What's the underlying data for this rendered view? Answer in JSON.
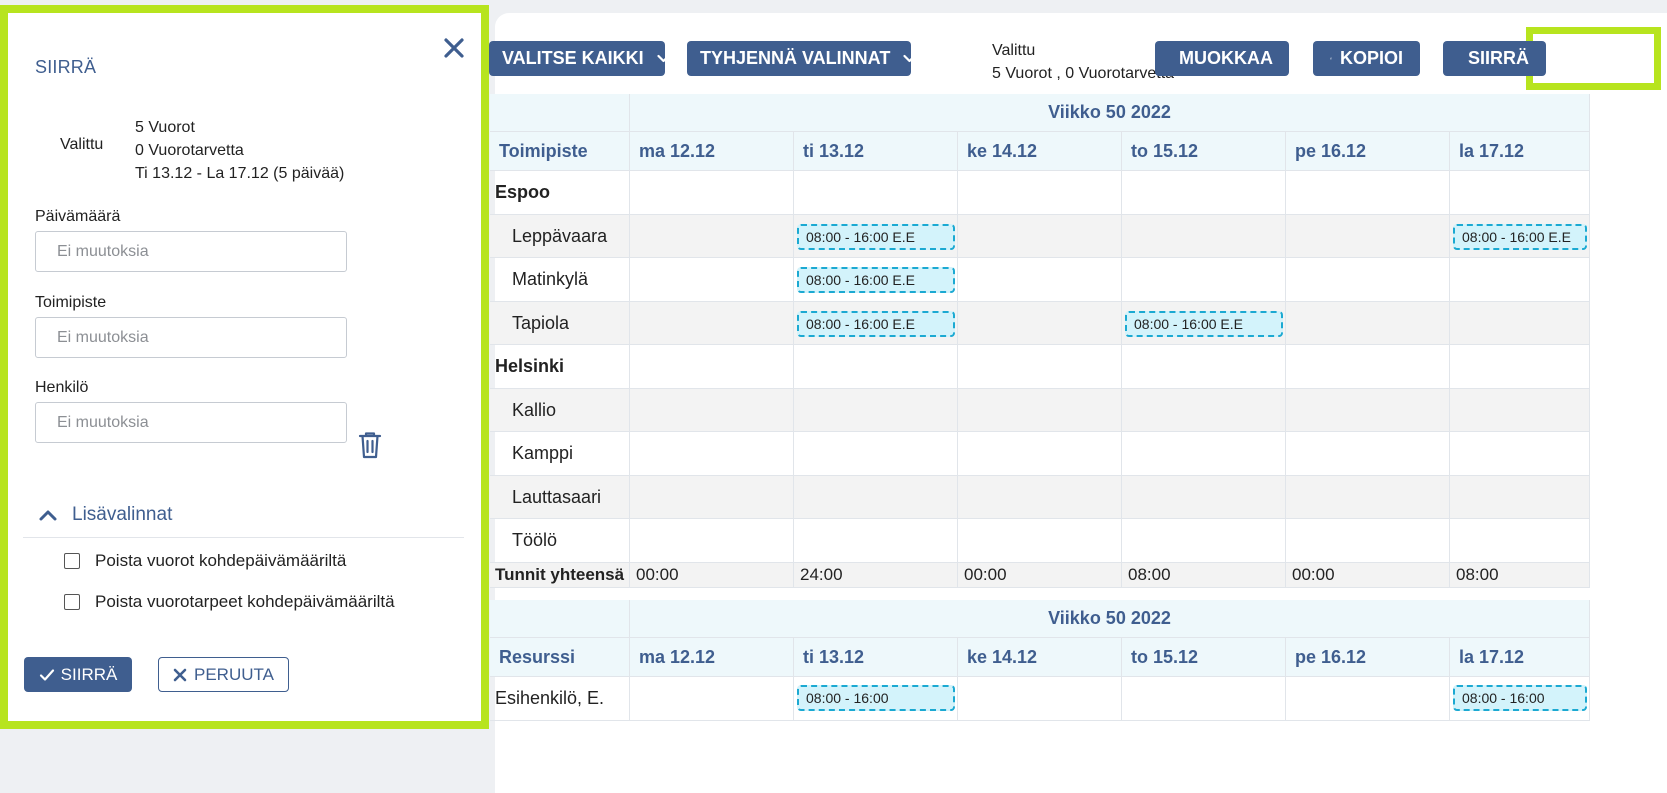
{
  "panel": {
    "title": "SIIRRÄ",
    "selected_label": "Valittu",
    "selected_lines": [
      "5 Vuorot",
      "0 Vuorotarvetta",
      "Ti 13.12 - La 17.12 (5 päivää)"
    ],
    "fields": [
      {
        "label": "Päivämäärä",
        "placeholder": "Ei muutoksia"
      },
      {
        "label": "Toimipiste",
        "placeholder": "Ei muutoksia"
      },
      {
        "label": "Henkilö",
        "placeholder": "Ei muutoksia"
      }
    ],
    "more_options_label": "Lisävalinnat",
    "checkboxes": [
      {
        "label": "Poista vuorot kohdepäivämääriltä",
        "checked": false
      },
      {
        "label": "Poista vuorotarpeet kohdepäivämääriltä",
        "checked": false
      }
    ],
    "submit_label": "SIIRRÄ",
    "cancel_label": "PERUUTA"
  },
  "toolbar": {
    "select_all": "VALITSE KAIKKI",
    "clear_selections": "TYHJENNÄ VALINNAT",
    "selected_title": "Valittu",
    "selected_summary": "5 Vuorot , 0 Vuorotarvetta",
    "edit": "MUOKKAA",
    "copy": "KOPIOI",
    "move": "SIIRRÄ"
  },
  "schedule": {
    "week_label": "Viikko 50 2022",
    "location_header": "Toimipiste",
    "days": [
      "ma 12.12",
      "ti 13.12",
      "ke 14.12",
      "to 15.12",
      "pe 16.12",
      "la 17.12"
    ],
    "rows": [
      {
        "label": "Espoo",
        "group": true,
        "shifts": [
          "",
          "",
          "",
          "",
          "",
          ""
        ]
      },
      {
        "label": "Leppävaara",
        "group": false,
        "shifts": [
          "",
          "08:00 - 16:00 E.E",
          "",
          "",
          "",
          "08:00 - 16:00 E.E"
        ]
      },
      {
        "label": "Matinkylä",
        "group": false,
        "shifts": [
          "",
          "08:00 - 16:00 E.E",
          "",
          "",
          "",
          ""
        ]
      },
      {
        "label": "Tapiola",
        "group": false,
        "shifts": [
          "",
          "08:00 - 16:00 E.E",
          "",
          "08:00 - 16:00 E.E",
          "",
          ""
        ]
      },
      {
        "label": "Helsinki",
        "group": true,
        "shifts": [
          "",
          "",
          "",
          "",
          "",
          ""
        ]
      },
      {
        "label": "Kallio",
        "group": false,
        "shifts": [
          "",
          "",
          "",
          "",
          "",
          ""
        ]
      },
      {
        "label": "Kamppi",
        "group": false,
        "shifts": [
          "",
          "",
          "",
          "",
          "",
          ""
        ]
      },
      {
        "label": "Lauttasaari",
        "group": false,
        "shifts": [
          "",
          "",
          "",
          "",
          "",
          ""
        ]
      },
      {
        "label": "Töölö",
        "group": false,
        "shifts": [
          "",
          "",
          "",
          "",
          "",
          ""
        ]
      }
    ],
    "totals_label": "Tunnit yhteensä",
    "totals": [
      "00:00",
      "24:00",
      "00:00",
      "08:00",
      "00:00",
      "08:00"
    ]
  },
  "resources": {
    "week_label": "Viikko 50 2022",
    "header": "Resurssi",
    "days": [
      "ma 12.12",
      "ti 13.12",
      "ke 14.12",
      "to 15.12",
      "pe 16.12",
      "la 17.12"
    ],
    "rows": [
      {
        "label": "Esihenkilö, E.",
        "shifts": [
          "",
          "08:00 - 16:00",
          "",
          "",
          "",
          "08:00 - 16:00"
        ]
      }
    ]
  }
}
